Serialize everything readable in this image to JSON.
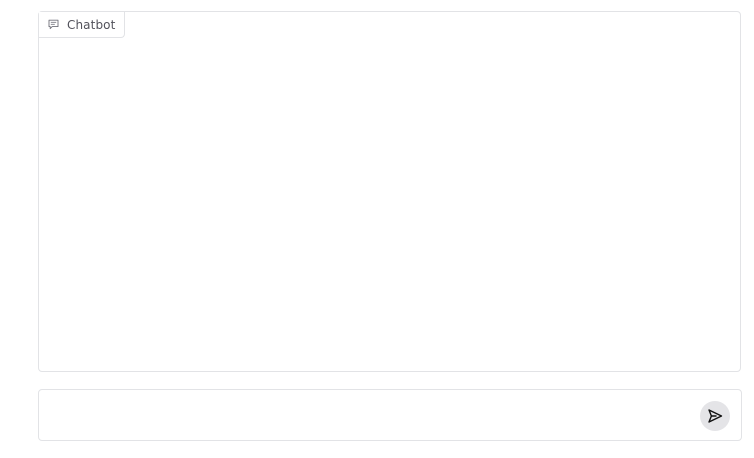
{
  "chatbot": {
    "label": "Chatbot",
    "icon": "chat-bubble-icon",
    "messages": []
  },
  "composer": {
    "value": "",
    "placeholder": "",
    "send_icon": "send-icon"
  }
}
